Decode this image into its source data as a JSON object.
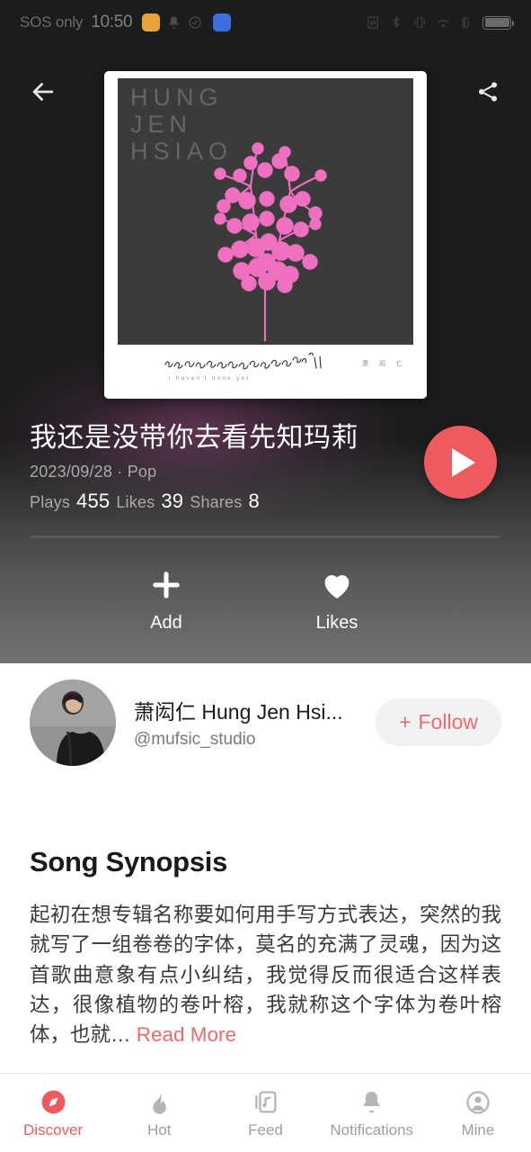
{
  "status_bar": {
    "carrier": "SOS only",
    "time": "10:50",
    "icons": [
      "app-orange-icon",
      "bell-icon",
      "circle-check-icon",
      "app-blue-icon",
      "nfc-icon",
      "bluetooth-icon",
      "vibrate-icon",
      "wifi-icon",
      "signal-icon",
      "battery-icon"
    ]
  },
  "top_nav": {
    "back_icon": "back-arrow-icon",
    "share_icon": "share-icon"
  },
  "album": {
    "brand_lines": [
      "HUNG",
      "JEN",
      "HSIAO"
    ],
    "handwritten_subtitle": "i haven't done yet",
    "footer_credit": "萧 闳 仁",
    "art_accent_color": "#ef6fc0",
    "art_background_color": "#3b3b3b"
  },
  "track": {
    "title": "我还是没带你去看先知玛莉",
    "date": "2023/09/28",
    "separator": "·",
    "genre": "Pop",
    "plays_label": "Plays",
    "plays_value": "455",
    "likes_label": "Likes",
    "likes_value": "39",
    "shares_label": "Shares",
    "shares_value": "8",
    "play_icon": "play-icon",
    "progress_percent": 0
  },
  "actions": [
    {
      "label": "Add",
      "icon": "plus-icon"
    },
    {
      "label": "Likes",
      "icon": "heart-icon"
    }
  ],
  "artist": {
    "name": "萧闳仁 Hung Jen Hsi...",
    "handle": "@mufsic_studio",
    "follow_plus": "+",
    "follow_label": "Follow",
    "avatar_icon": "avatar"
  },
  "synopsis": {
    "heading": "Song Synopsis",
    "body": "起初在想专辑名称要如何用手写方式表达，突然的我就写了一组卷卷的字体，莫名的充满了灵魂，因为这首歌曲意象有点小纠结，我觉得反而很适合这样表达，很像植物的卷叶榕，我就称这个字体为卷叶榕体，也就… ",
    "read_more": "Read More"
  },
  "bottom_nav": {
    "items": [
      {
        "label": "Discover",
        "icon": "compass-icon",
        "active": true
      },
      {
        "label": "Hot",
        "icon": "flame-icon",
        "active": false
      },
      {
        "label": "Feed",
        "icon": "music-card-icon",
        "active": false
      },
      {
        "label": "Notifications",
        "icon": "bell-icon",
        "active": false
      },
      {
        "label": "Mine",
        "icon": "person-circle-icon",
        "active": false
      }
    ]
  },
  "colors": {
    "accent": "#ef5a5f",
    "accent_soft": "#ef6a6a",
    "hero_background": "#1c1c1c",
    "page_background": "#ffffff"
  }
}
